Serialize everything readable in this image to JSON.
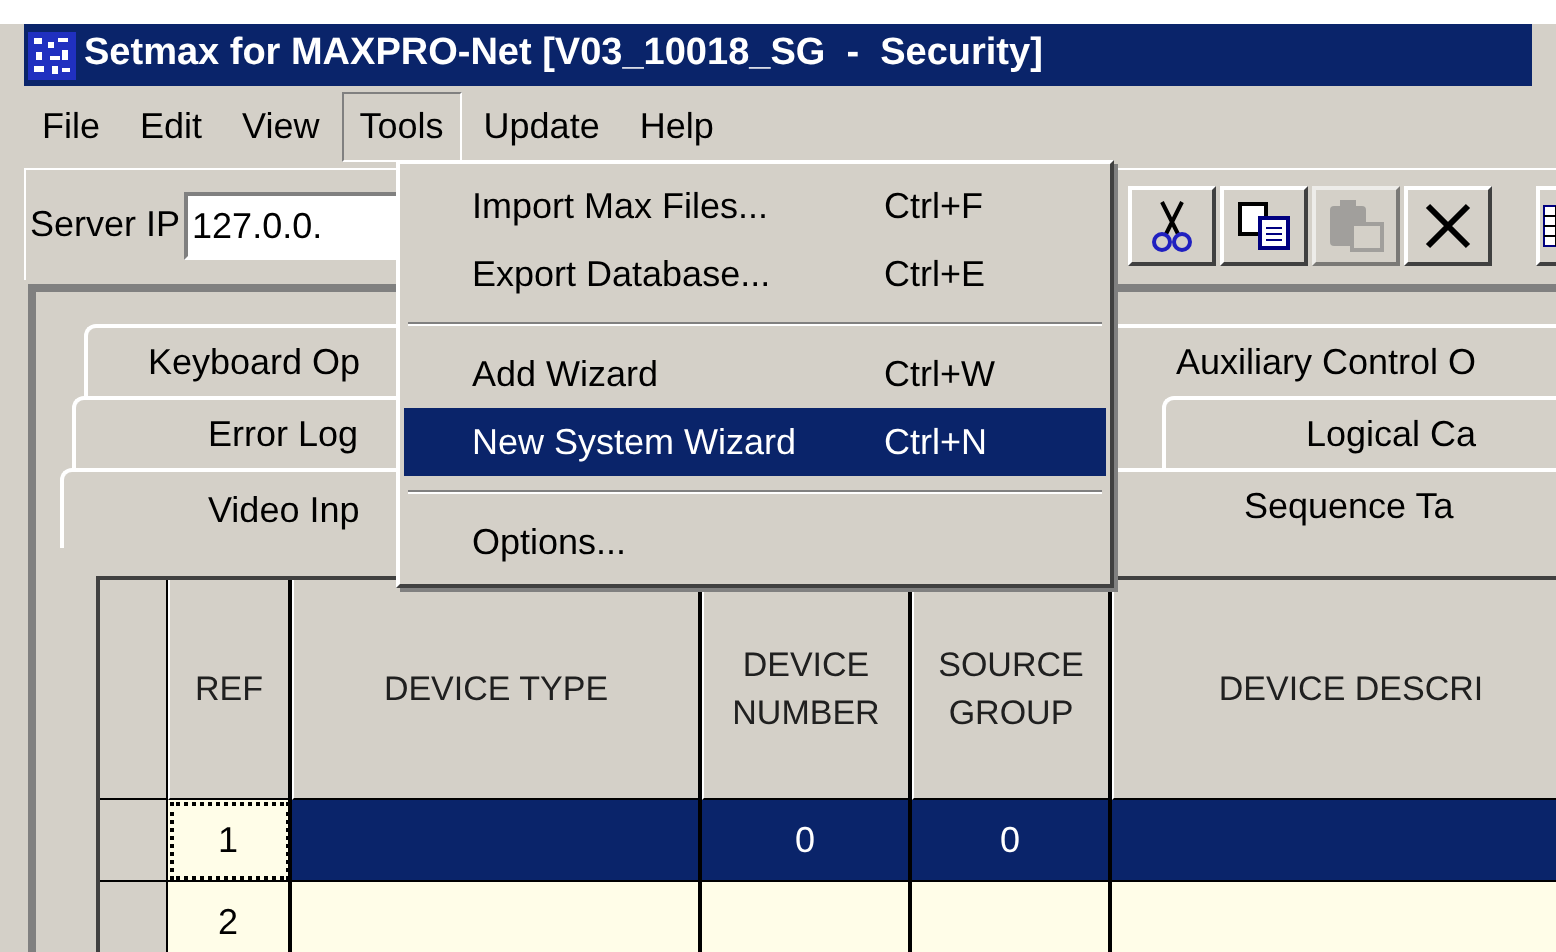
{
  "window": {
    "title": "Setmax for MAXPRO-Net [V03_10018_SG  -  Security]"
  },
  "menu_bar": [
    {
      "label": "File",
      "selected": false
    },
    {
      "label": "Edit",
      "selected": false
    },
    {
      "label": "View",
      "selected": false
    },
    {
      "label": "Tools",
      "selected": true
    },
    {
      "label": "Update",
      "selected": false
    },
    {
      "label": "Help",
      "selected": false
    }
  ],
  "toolbar": {
    "server_ip_label": "Server IP",
    "server_ip_value": "127.0.0.",
    "buttons": [
      {
        "kind": "cut",
        "disabled": false
      },
      {
        "kind": "copy",
        "disabled": false
      },
      {
        "kind": "paste",
        "disabled": true
      },
      {
        "kind": "delete",
        "disabled": false
      },
      {
        "kind": "grid",
        "disabled": false
      }
    ]
  },
  "tools_menu": [
    {
      "kind": "item",
      "label": "Import Max Files...",
      "shortcut": "Ctrl+F",
      "selected": false
    },
    {
      "kind": "item",
      "label": "Export Database...",
      "shortcut": "Ctrl+E",
      "selected": false
    },
    {
      "kind": "separator"
    },
    {
      "kind": "item",
      "label": "Add Wizard",
      "shortcut": "Ctrl+W",
      "selected": false
    },
    {
      "kind": "item",
      "label": "New System Wizard",
      "shortcut": "Ctrl+N",
      "selected": true
    },
    {
      "kind": "separator"
    },
    {
      "kind": "item",
      "label": "Options...",
      "selected": false
    }
  ],
  "tab_rows": [
    [
      {
        "label": "Keyboard Op",
        "selected": false
      },
      {
        "label": "Auxiliary Control O",
        "selected": false
      }
    ],
    [
      {
        "label": "Error Log",
        "selected": false
      },
      {
        "label": "Logical Ca",
        "selected": false
      }
    ],
    [
      {
        "label": "Video Inp",
        "selected": true
      },
      {
        "label": "Sequence Ta",
        "selected": false
      }
    ]
  ],
  "table": {
    "columns": [
      "REF",
      "DEVICE TYPE",
      "DEVICE\nNUMBER",
      "SOURCE\nGROUP",
      "DEVICE DESCRI"
    ],
    "rows": [
      {
        "selected": true,
        "cells": [
          "1",
          "",
          "0",
          "0",
          ""
        ]
      },
      {
        "selected": false,
        "cells": [
          "2",
          "",
          "",
          "",
          ""
        ]
      }
    ]
  }
}
